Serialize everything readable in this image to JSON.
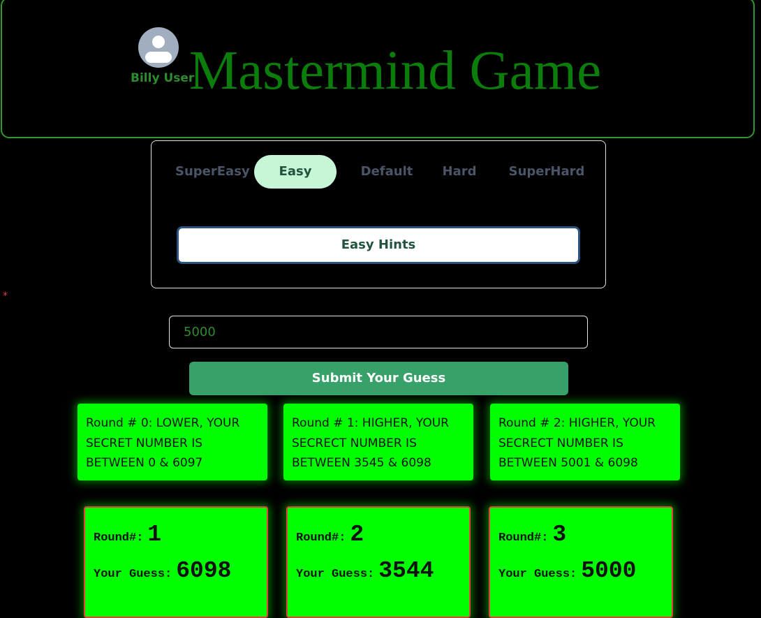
{
  "header": {
    "user_name": "Billy User",
    "title": "Mastermind Game"
  },
  "difficulty": {
    "tabs": [
      {
        "label": "SuperEasy",
        "active": false
      },
      {
        "label": "Easy",
        "active": true
      },
      {
        "label": "Default",
        "active": false
      },
      {
        "label": "Hard",
        "active": false
      },
      {
        "label": "SuperHard",
        "active": false
      }
    ],
    "hints_button": "Easy Hints"
  },
  "form": {
    "required_marker": "*",
    "guess_value": "5000",
    "submit_label": "Submit Your Guess"
  },
  "hints": [
    {
      "text": "Round # 0: LOWER, YOUR SECRET NUMBER IS BETWEEN 0 & 6097"
    },
    {
      "text": "Round # 1: HIGHER, YOUR SECRECT NUMBER IS BETWEEN 3545 & 6098"
    },
    {
      "text": "Round # 2: HIGHER, YOUR SECRECT NUMBER IS BETWEEN 5001 & 6098"
    }
  ],
  "rounds": [
    {
      "round_label": "Round#:",
      "round": "1",
      "guess_label": "Your Guess:",
      "guess": "6098"
    },
    {
      "round_label": "Round#:",
      "round": "2",
      "guess_label": "Your Guess:",
      "guess": "3544"
    },
    {
      "round_label": "Round#:",
      "round": "3",
      "guess_label": "Your Guess:",
      "guess": "5000"
    }
  ],
  "colors": {
    "accent_green": "#00ff00",
    "title_green": "#0b7d0b",
    "active_tab": "#c6f6d5",
    "submit_green": "#38a169",
    "card_border_red": "#e53e3e"
  }
}
